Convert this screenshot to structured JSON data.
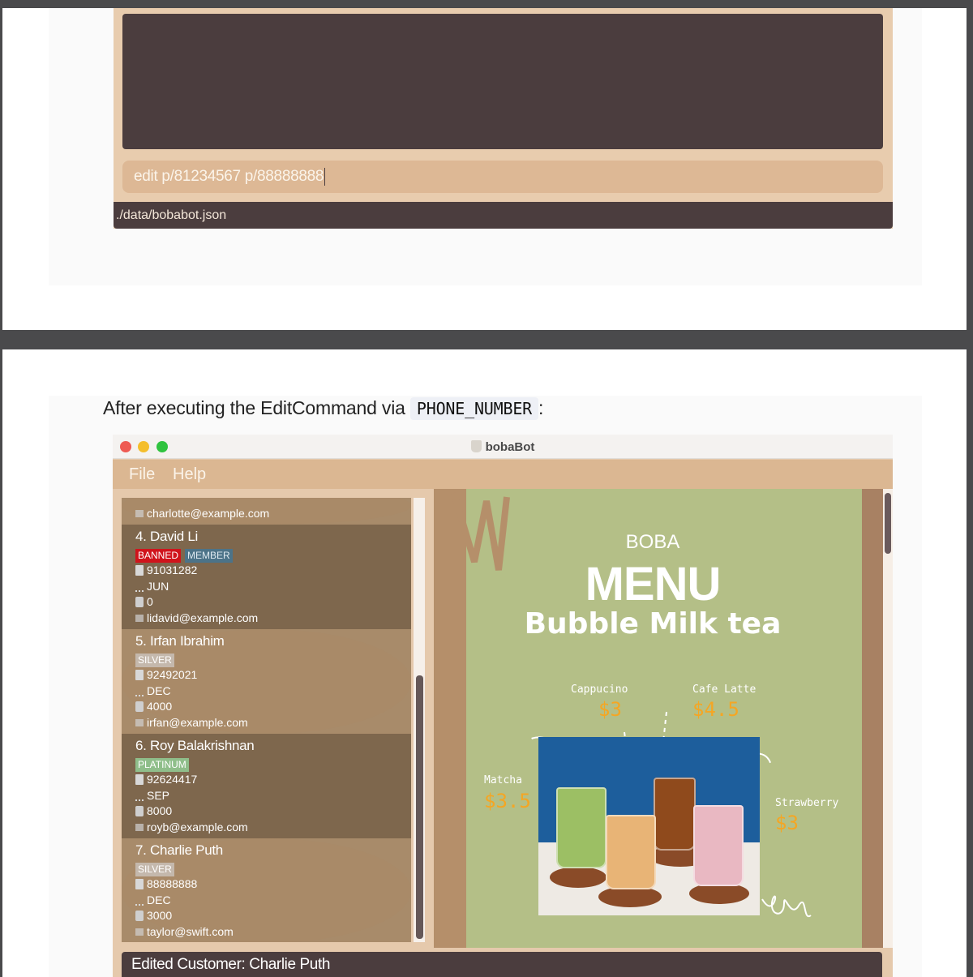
{
  "top_section": {
    "command_input": "edit p/81234567 p/88888888",
    "status_path": "./data/bobabot.json"
  },
  "heading": {
    "text": "After executing the EditCommand via",
    "code": "PHONE_NUMBER",
    "suffix": ":"
  },
  "window": {
    "title": "bobaBot",
    "menu": [
      "File",
      "Help"
    ]
  },
  "customers": [
    {
      "partial_top": true,
      "email": "charlotte@example.com"
    },
    {
      "name": "4.  David Li",
      "tags": [
        "BANNED",
        "MEMBER"
      ],
      "phone": "91031282",
      "birthday_month": "JUN",
      "reward": "0",
      "email": "lidavid@example.com"
    },
    {
      "name": "5.  Irfan Ibrahim",
      "tags": [
        "SILVER"
      ],
      "phone": "92492021",
      "birthday_month": "DEC",
      "reward": "4000",
      "email": "irfan@example.com"
    },
    {
      "name": "6.  Roy Balakrishnan",
      "tags": [
        "PLATINUM"
      ],
      "phone": "92624417",
      "birthday_month": "SEP",
      "reward": "8000",
      "email": "royb@example.com"
    },
    {
      "name": "7.  Charlie Puth",
      "tags": [
        "SILVER"
      ],
      "phone": "88888888",
      "birthday_month": "DEC",
      "reward": "3000",
      "email": "taylor@swift.com"
    }
  ],
  "menu_image": {
    "brand": "BOBA",
    "title": "MENU",
    "subtitle": "Bubble Milk tea",
    "drinks": [
      {
        "name": "Cappucino",
        "price": "$3"
      },
      {
        "name": "Cafe Latte",
        "price": "$4.5"
      },
      {
        "name": "Matcha",
        "price": "$3.5"
      },
      {
        "name": "Strawberry",
        "price": "$3"
      }
    ]
  },
  "result_message": "Edited Customer: Charlie Puth",
  "colors": {
    "panel_dark": "#4b3d3e",
    "menu_bar": "#dbb792",
    "card_dark": "#7e674d",
    "card_light": "#a98a68",
    "menu_bg": "#b4bf87",
    "price": "#f5a623",
    "tag_banned": "#d0131b",
    "tag_member": "#4c7388",
    "tag_platinum": "#8fbe8a"
  }
}
